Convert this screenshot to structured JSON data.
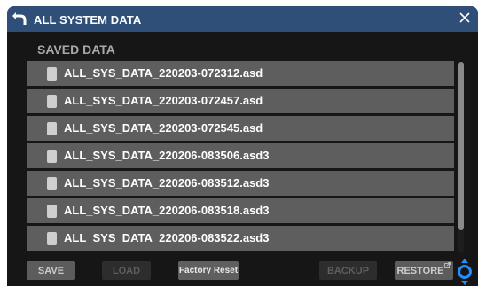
{
  "window": {
    "title": "ALL SYSTEM DATA",
    "titlebar_color": "#2f4f79",
    "back_icon": "back-arrow-icon",
    "close_icon": "close-icon"
  },
  "section_title": "SAVED DATA",
  "files": [
    "ALL_SYS_DATA_220203-072312.asd",
    "ALL_SYS_DATA_220203-072457.asd",
    "ALL_SYS_DATA_220203-072545.asd",
    "ALL_SYS_DATA_220206-083506.asd3",
    "ALL_SYS_DATA_220206-083512.asd3",
    "ALL_SYS_DATA_220206-083518.asd3",
    "ALL_SYS_DATA_220206-083522.asd3"
  ],
  "buttons": {
    "save": "SAVE",
    "load": "LOAD",
    "factory_reset": "Factory Reset",
    "backup": "BACKUP",
    "restore": "RESTORE"
  },
  "button_states": {
    "save": "enabled",
    "load": "disabled",
    "factory_reset": "enabled",
    "backup": "disabled",
    "restore": "enabled"
  },
  "accent_color": "#1e90ff"
}
